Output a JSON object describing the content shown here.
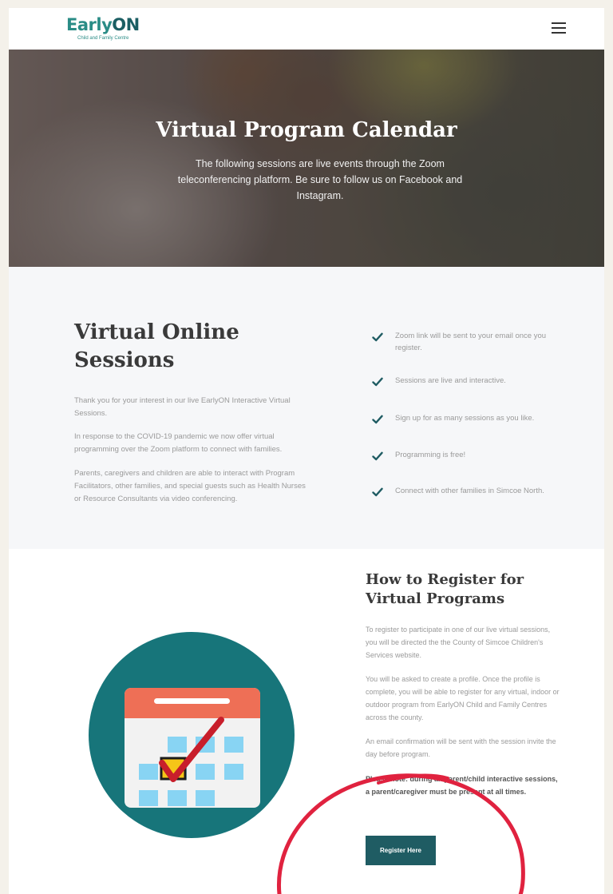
{
  "brand": {
    "logo_early": "Early",
    "logo_on": "ON",
    "logo_sub": "Child and Family Centre",
    "teal": "#2a8c86",
    "dark_teal": "#1f5c63"
  },
  "header": {
    "menu_icon": "hamburger-menu-icon"
  },
  "hero": {
    "title": "Virtual Program Calendar",
    "text": "The following sessions are live events through the Zoom teleconferencing platform. Be sure to follow us on Facebook and Instagram."
  },
  "sessions": {
    "title": "Virtual Online Sessions",
    "paragraphs": [
      "Thank you for your interest in our live EarlyON Interactive Virtual Sessions.",
      "In response to the COVID-19 pandemic we now offer virtual programming over the Zoom platform to connect with families.",
      "Parents, caregivers and children are able to interact with Program Facilitators, other families, and special guests such as Health Nurses or Resource Consultants via video conferencing."
    ],
    "checklist": [
      "Zoom link will be sent to your email once you register.",
      "Sessions are live and interactive.",
      "Sign up for as many sessions as you like.",
      "Programming is free!",
      "Connect with other families in Simcoe North."
    ],
    "check_icon": "checkmark-icon"
  },
  "register": {
    "title": "How to Register for Virtual Programs",
    "paragraphs": [
      "To register to participate in one of our live virtual sessions, you will be directed the the County of Simcoe Children's Services website.",
      "You will be asked to create a profile. Once the profile is complete, you will be able to register for any virtual, indoor or outdoor program from EarlyON Child and Family Centres across the county.",
      "An email confirmation will be sent with the session invite the day before program."
    ],
    "note": "Please note: during all parent/child interactive sessions, a parent/caregiver must be present at all times.",
    "button_label": "Register Here",
    "illustration_icon": "calendar-check-icon"
  }
}
